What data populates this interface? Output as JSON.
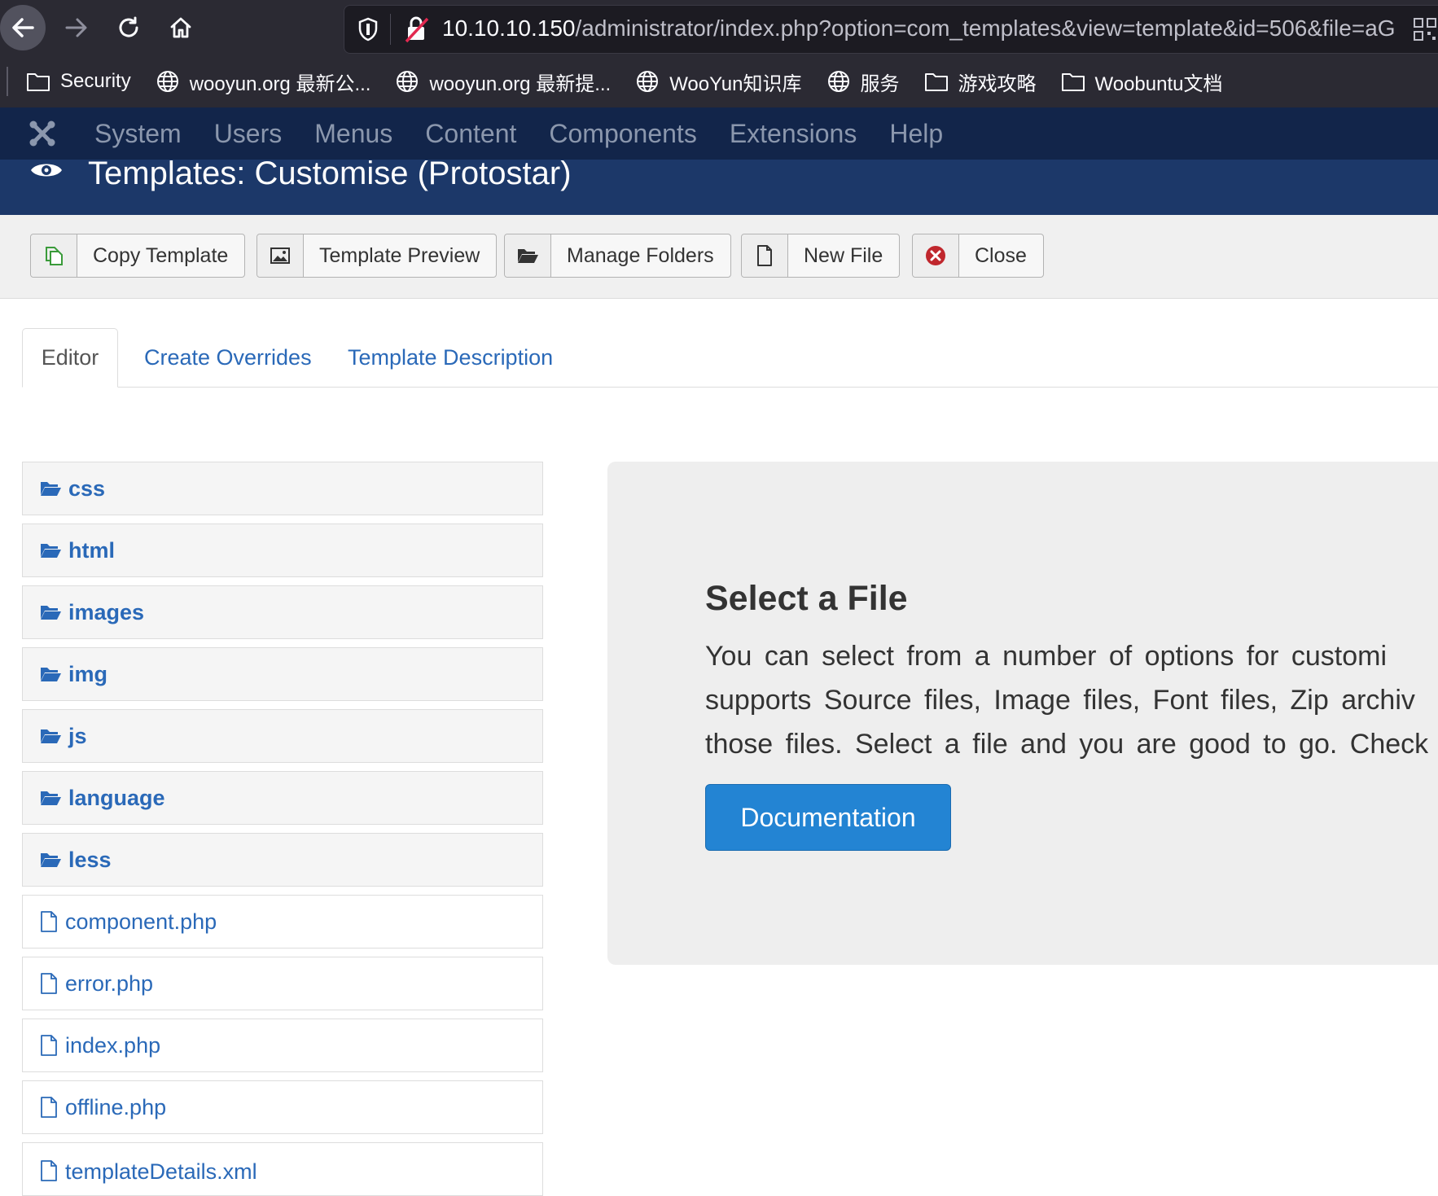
{
  "browser": {
    "url_host": "10.10.10.150",
    "url_path": "/administrator/index.php?option=com_templates&view=template&id=506&file=aG",
    "bookmarks": [
      {
        "label": "Security",
        "icon": "folder-icon"
      },
      {
        "label": "wooyun.org 最新公...",
        "icon": "globe-icon"
      },
      {
        "label": "wooyun.org 最新提...",
        "icon": "globe-icon"
      },
      {
        "label": "WooYun知识库",
        "icon": "globe-icon"
      },
      {
        "label": "服务",
        "icon": "globe-icon"
      },
      {
        "label": "游戏攻略",
        "icon": "folder-icon"
      },
      {
        "label": "Woobuntu文档",
        "icon": "folder-icon"
      }
    ]
  },
  "admin_menu": [
    "System",
    "Users",
    "Menus",
    "Content",
    "Components",
    "Extensions",
    "Help"
  ],
  "page_title": "Templates: Customise (Protostar)",
  "toolbar": {
    "copy_template": "Copy Template",
    "template_preview": "Template Preview",
    "manage_folders": "Manage Folders",
    "new_file": "New File",
    "close": "Close"
  },
  "tabs": {
    "editor": "Editor",
    "create_overrides": "Create Overrides",
    "template_description": "Template Description"
  },
  "files": [
    {
      "name": "css",
      "type": "folder"
    },
    {
      "name": "html",
      "type": "folder"
    },
    {
      "name": "images",
      "type": "folder"
    },
    {
      "name": "img",
      "type": "folder"
    },
    {
      "name": "js",
      "type": "folder"
    },
    {
      "name": "language",
      "type": "folder"
    },
    {
      "name": "less",
      "type": "folder"
    },
    {
      "name": "component.php",
      "type": "file"
    },
    {
      "name": "error.php",
      "type": "file"
    },
    {
      "name": "index.php",
      "type": "file"
    },
    {
      "name": "offline.php",
      "type": "file"
    },
    {
      "name": "templateDetails.xml",
      "type": "file"
    }
  ],
  "info_panel": {
    "title": "Select a File",
    "lines": [
      "You can select from a number of options for customi",
      "supports Source files, Image files, Font files, Zip archiv",
      "those files. Select a file and you are good to go. Check t"
    ],
    "button": "Documentation"
  },
  "colors": {
    "nav_bg": "#12254a",
    "title_bg": "#1c3869",
    "link": "#2a69b8",
    "doc_button": "#2384d3",
    "close_icon": "#c0272d"
  }
}
